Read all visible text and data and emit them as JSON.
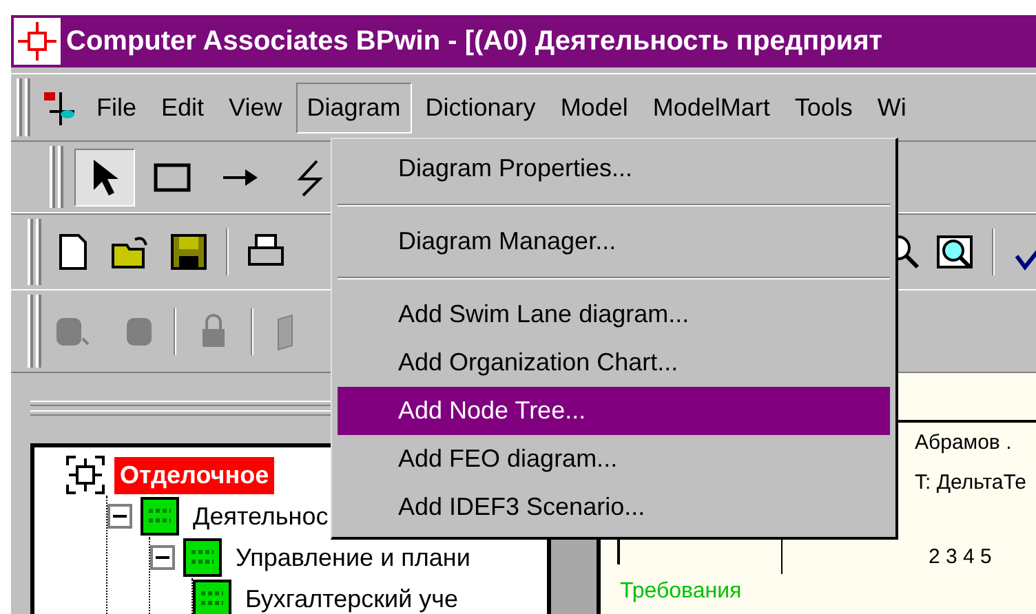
{
  "window": {
    "title": "Computer Associates BPwin - [(A0) Деятельность предприят"
  },
  "menubar": [
    {
      "label": "File",
      "selected": false
    },
    {
      "label": "Edit",
      "selected": false
    },
    {
      "label": "View",
      "selected": false
    },
    {
      "label": "Diagram",
      "selected": true
    },
    {
      "label": "Dictionary",
      "selected": false
    },
    {
      "label": "Model",
      "selected": false
    },
    {
      "label": "ModelMart",
      "selected": false
    },
    {
      "label": "Tools",
      "selected": false
    },
    {
      "label": "Wi",
      "selected": false
    }
  ],
  "menu": {
    "items": [
      {
        "kind": "item",
        "label": "Diagram Properties...",
        "selected": false
      },
      {
        "kind": "separator"
      },
      {
        "kind": "item",
        "label": "Diagram Manager...",
        "selected": false
      },
      {
        "kind": "separator"
      },
      {
        "kind": "item",
        "label": "Add Swim Lane diagram...",
        "selected": false
      },
      {
        "kind": "item",
        "label": "Add Organization Chart...",
        "selected": false
      },
      {
        "kind": "item",
        "label": "Add Node Tree...",
        "selected": true
      },
      {
        "kind": "item",
        "label": "Add FEO diagram...",
        "selected": false
      },
      {
        "kind": "item",
        "label": "Add IDEF3 Scenario...",
        "selected": false
      }
    ]
  },
  "tree": [
    {
      "label": "Отделочное",
      "selected": true,
      "children": [
        {
          "label": "Деятельнос",
          "selected": false,
          "expanded": true,
          "children": [
            {
              "label": "Управление и плани",
              "selected": false,
              "expanded": true,
              "children": [
                {
                  "label": "Бухгалтерский уче",
                  "selected": false
                }
              ]
            }
          ]
        }
      ]
    }
  ],
  "diagram": {
    "author": "Абрамов .",
    "project": "T:  ДельтаТе",
    "numbers": "2 3 4 5",
    "node_label": "Требования"
  }
}
